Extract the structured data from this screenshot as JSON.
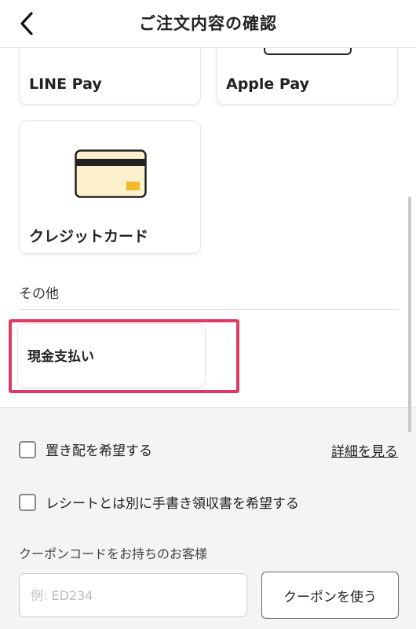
{
  "header": {
    "title": "ご注文内容の確認",
    "back_icon": "chevron-left-icon"
  },
  "payment_methods": {
    "line_pay": {
      "label": "LINE Pay"
    },
    "apple_pay": {
      "label": "Apple Pay"
    },
    "credit_card": {
      "label": "クレジットカード",
      "icon": "credit-card-icon"
    },
    "other_section_label": "その他",
    "cash": {
      "label": "現金支払い",
      "highlighted": true
    }
  },
  "options": {
    "okihai_label": "置き配を希望する",
    "okihai_checked": false,
    "details_link": "詳細を見る",
    "receipt_label": "レシートとは別に手書き領収書を希望する",
    "receipt_checked": false
  },
  "coupon": {
    "label": "クーポンコードをお持ちのお客様",
    "placeholder": "例: ED234",
    "value": "",
    "button_label": "クーポンを使う"
  },
  "colors": {
    "highlight": "#e03a62",
    "card_fill": "#fdf0cc",
    "card_chip": "#f5b92a"
  }
}
